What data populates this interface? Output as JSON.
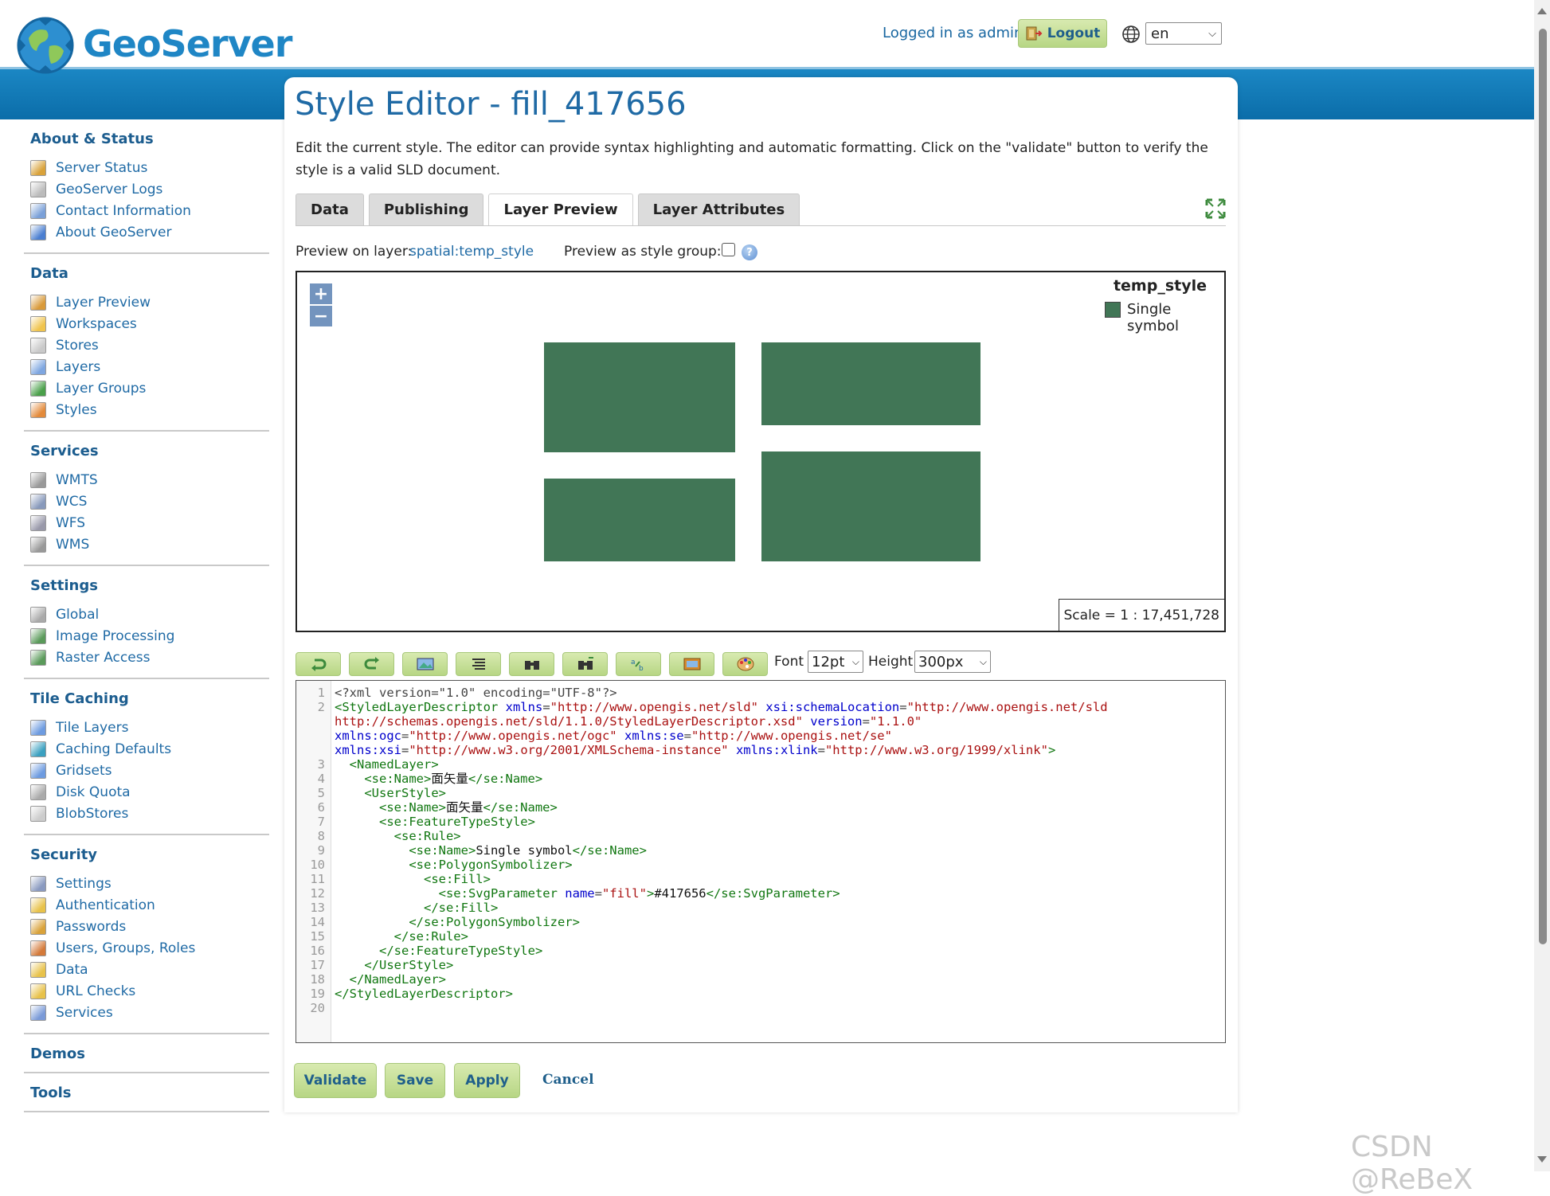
{
  "header": {
    "logo_text": "GeoServer",
    "login_status": "Logged in as admin.",
    "logout_label": "Logout",
    "language": "en"
  },
  "sidebar": {
    "sections": [
      {
        "title": "About & Status",
        "items": [
          {
            "label": "Server Status",
            "icon": "server-status-icon"
          },
          {
            "label": "GeoServer Logs",
            "icon": "logs-icon"
          },
          {
            "label": "Contact Information",
            "icon": "contact-icon"
          },
          {
            "label": "About GeoServer",
            "icon": "about-icon"
          }
        ]
      },
      {
        "title": "Data",
        "items": [
          {
            "label": "Layer Preview",
            "icon": "layer-preview-icon"
          },
          {
            "label": "Workspaces",
            "icon": "workspaces-icon"
          },
          {
            "label": "Stores",
            "icon": "stores-icon"
          },
          {
            "label": "Layers",
            "icon": "layers-icon"
          },
          {
            "label": "Layer Groups",
            "icon": "layer-groups-icon"
          },
          {
            "label": "Styles",
            "icon": "styles-icon"
          }
        ]
      },
      {
        "title": "Services",
        "items": [
          {
            "label": "WMTS",
            "icon": "wmts-icon"
          },
          {
            "label": "WCS",
            "icon": "wcs-icon"
          },
          {
            "label": "WFS",
            "icon": "wfs-icon"
          },
          {
            "label": "WMS",
            "icon": "wms-icon"
          }
        ]
      },
      {
        "title": "Settings",
        "items": [
          {
            "label": "Global",
            "icon": "global-icon"
          },
          {
            "label": "Image Processing",
            "icon": "image-processing-icon"
          },
          {
            "label": "Raster Access",
            "icon": "raster-access-icon"
          }
        ]
      },
      {
        "title": "Tile Caching",
        "items": [
          {
            "label": "Tile Layers",
            "icon": "tile-layers-icon"
          },
          {
            "label": "Caching Defaults",
            "icon": "caching-defaults-icon"
          },
          {
            "label": "Gridsets",
            "icon": "gridsets-icon"
          },
          {
            "label": "Disk Quota",
            "icon": "disk-quota-icon"
          },
          {
            "label": "BlobStores",
            "icon": "blobstores-icon"
          }
        ]
      },
      {
        "title": "Security",
        "items": [
          {
            "label": "Settings",
            "icon": "security-settings-icon"
          },
          {
            "label": "Authentication",
            "icon": "authentication-icon"
          },
          {
            "label": "Passwords",
            "icon": "passwords-icon"
          },
          {
            "label": "Users, Groups, Roles",
            "icon": "users-icon"
          },
          {
            "label": "Data",
            "icon": "security-data-icon"
          },
          {
            "label": "URL Checks",
            "icon": "url-checks-icon"
          },
          {
            "label": "Services",
            "icon": "security-services-icon"
          }
        ]
      },
      {
        "title": "Demos",
        "items": []
      },
      {
        "title": "Tools",
        "items": []
      }
    ]
  },
  "main": {
    "title": "Style Editor - fill_417656",
    "description": "Edit the current style. The editor can provide syntax highlighting and automatic formatting. Click on the \"validate\" button to verify the style is a valid SLD document.",
    "tabs": [
      {
        "label": "Data",
        "active": false
      },
      {
        "label": "Publishing",
        "active": false
      },
      {
        "label": "Layer Preview",
        "active": true
      },
      {
        "label": "Layer Attributes",
        "active": false
      }
    ],
    "preview_label": "Preview on layer:",
    "preview_layer": "spatial:temp_style",
    "group_label": "Preview as style group:",
    "group_checked": false
  },
  "map": {
    "zoom_in": "+",
    "zoom_out": "−",
    "legend_title": "temp_style",
    "legend_label": "Single symbol",
    "fill_color": "#417656",
    "scale": "Scale = 1 : 17,451,728"
  },
  "editor_toolbar": {
    "font_label": "Font",
    "font_value": "12pt",
    "height_label": "Height",
    "height_value": "300px"
  },
  "code_lines": [
    {
      "n": "1",
      "parts": [
        [
          "plain",
          "<?xml version=\"1.0\" encoding=\"UTF-8\"?>"
        ]
      ]
    },
    {
      "n": "2",
      "parts": [
        [
          "tag",
          "<StyledLayerDescriptor "
        ],
        [
          "attr",
          "xmlns"
        ],
        [
          "plain",
          "="
        ],
        [
          "str",
          "\"http://www.opengis.net/sld\""
        ],
        [
          "plain",
          " "
        ],
        [
          "attr",
          "xsi:schemaLocation"
        ],
        [
          "plain",
          "="
        ],
        [
          "str",
          "\"http://www.opengis.net/sld"
        ]
      ]
    },
    {
      "n": "",
      "parts": [
        [
          "str",
          "http://schemas.opengis.net/sld/1.1.0/StyledLayerDescriptor.xsd\""
        ],
        [
          "plain",
          " "
        ],
        [
          "attr",
          "version"
        ],
        [
          "plain",
          "="
        ],
        [
          "str",
          "\"1.1.0\""
        ]
      ]
    },
    {
      "n": "",
      "parts": [
        [
          "attr",
          "xmlns:ogc"
        ],
        [
          "plain",
          "="
        ],
        [
          "str",
          "\"http://www.opengis.net/ogc\""
        ],
        [
          "plain",
          " "
        ],
        [
          "attr",
          "xmlns:se"
        ],
        [
          "plain",
          "="
        ],
        [
          "str",
          "\"http://www.opengis.net/se\""
        ]
      ]
    },
    {
      "n": "",
      "parts": [
        [
          "attr",
          "xmlns:xsi"
        ],
        [
          "plain",
          "="
        ],
        [
          "str",
          "\"http://www.w3.org/2001/XMLSchema-instance\""
        ],
        [
          "plain",
          " "
        ],
        [
          "attr",
          "xmlns:xlink"
        ],
        [
          "plain",
          "="
        ],
        [
          "str",
          "\"http://www.w3.org/1999/xlink\""
        ],
        [
          "tag",
          ">"
        ]
      ]
    },
    {
      "n": "3",
      "parts": [
        [
          "tag",
          "  <NamedLayer>"
        ]
      ]
    },
    {
      "n": "4",
      "parts": [
        [
          "tag",
          "    <se:Name>"
        ],
        [
          "text",
          "面矢量"
        ],
        [
          "tag",
          "</se:Name>"
        ]
      ]
    },
    {
      "n": "5",
      "parts": [
        [
          "tag",
          "    <UserStyle>"
        ]
      ]
    },
    {
      "n": "6",
      "parts": [
        [
          "tag",
          "      <se:Name>"
        ],
        [
          "text",
          "面矢量"
        ],
        [
          "tag",
          "</se:Name>"
        ]
      ]
    },
    {
      "n": "7",
      "parts": [
        [
          "tag",
          "      <se:FeatureTypeStyle>"
        ]
      ]
    },
    {
      "n": "8",
      "parts": [
        [
          "tag",
          "        <se:Rule>"
        ]
      ]
    },
    {
      "n": "9",
      "parts": [
        [
          "tag",
          "          <se:Name>"
        ],
        [
          "text",
          "Single symbol"
        ],
        [
          "tag",
          "</se:Name>"
        ]
      ]
    },
    {
      "n": "10",
      "parts": [
        [
          "tag",
          "          <se:PolygonSymbolizer>"
        ]
      ]
    },
    {
      "n": "11",
      "parts": [
        [
          "tag",
          "            <se:Fill>"
        ]
      ]
    },
    {
      "n": "12",
      "parts": [
        [
          "tag",
          "              <se:SvgParameter "
        ],
        [
          "attr",
          "name"
        ],
        [
          "plain",
          "="
        ],
        [
          "str",
          "\"fill\""
        ],
        [
          "tag",
          ">"
        ],
        [
          "text",
          "#417656"
        ],
        [
          "tag",
          "</se:SvgParameter>"
        ]
      ]
    },
    {
      "n": "13",
      "parts": [
        [
          "tag",
          "            </se:Fill>"
        ]
      ]
    },
    {
      "n": "14",
      "parts": [
        [
          "tag",
          "          </se:PolygonSymbolizer>"
        ]
      ]
    },
    {
      "n": "15",
      "parts": [
        [
          "tag",
          "        </se:Rule>"
        ]
      ]
    },
    {
      "n": "16",
      "parts": [
        [
          "tag",
          "      </se:FeatureTypeStyle>"
        ]
      ]
    },
    {
      "n": "17",
      "parts": [
        [
          "tag",
          "    </UserStyle>"
        ]
      ]
    },
    {
      "n": "18",
      "parts": [
        [
          "tag",
          "  </NamedLayer>"
        ]
      ]
    },
    {
      "n": "19",
      "parts": [
        [
          "tag",
          "</StyledLayerDescriptor>"
        ]
      ]
    },
    {
      "n": "20",
      "parts": []
    }
  ],
  "actions": {
    "validate": "Validate",
    "save": "Save",
    "apply": "Apply",
    "cancel": "Cancel"
  },
  "watermark": "CSDN @ReBeX"
}
